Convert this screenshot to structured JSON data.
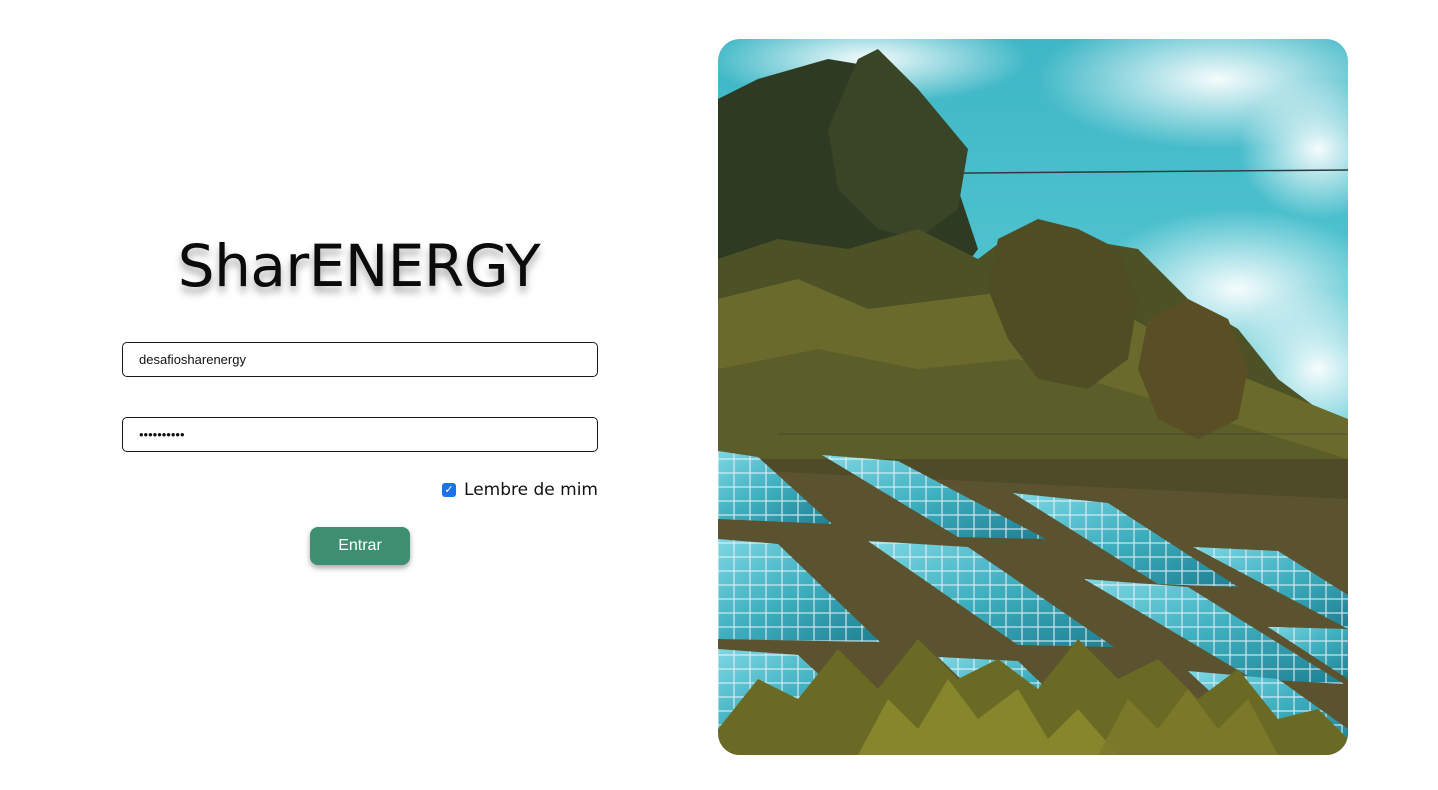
{
  "brand": {
    "title": "SharENERGY"
  },
  "login": {
    "username_value": "desafiosharenergy",
    "password_value": "••••••••••",
    "remember_label": "Lembre de mim",
    "remember_checked": true,
    "submit_label": "Entrar"
  },
  "colors": {
    "button": "#3e8f72",
    "checkbox": "#1a73e8"
  },
  "hero": {
    "icon": "solar-panels-photo"
  }
}
